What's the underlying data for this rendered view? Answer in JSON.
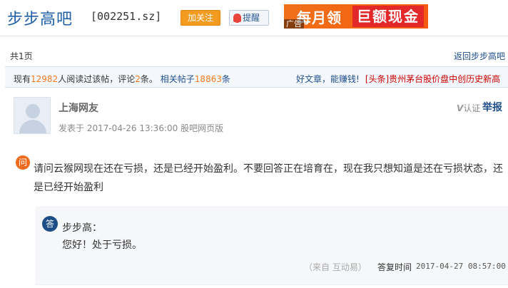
{
  "header": {
    "bar_name": "步步高吧",
    "stock_code": "[002251.sz]",
    "follow_label": "加关注",
    "remind_label": "提醒",
    "ad": {
      "text_part1": "每月领",
      "text_part2": "巨额现金",
      "tag": "广告"
    }
  },
  "pager": {
    "page_count": "共1页",
    "back_link": "返回步步高吧"
  },
  "stats": {
    "prefix": "现有",
    "readers": "12982",
    "readers_suffix": "人阅读过该帖，评论",
    "comments": "2",
    "comments_suffix": "条。",
    "related_label": "相关帖子",
    "related_count": "18863",
    "related_suffix": "条",
    "good_article": "好文章，能赚钱!",
    "headline": "[头条]贵州茅台股价盘中创历史新高"
  },
  "post": {
    "author": "上海网友",
    "meta": "发表于 2017-04-26 13:36:00 股吧网页版",
    "v_auth_v": "V",
    "v_auth_label": "认证",
    "report_label": "举报",
    "q_badge": "问",
    "question": "请问云猴网现在还在亏损，还是已经开始盈利。不要回答正在培育在，现在我只想知道是还在亏损状态，还是已经开始盈利"
  },
  "answer": {
    "badge": "答",
    "name": "步步高：",
    "text": "您好！处于亏损。",
    "source": "（来自 互动易）",
    "time_label": "答复时间",
    "time": "2017-04-27 08:57:00"
  }
}
